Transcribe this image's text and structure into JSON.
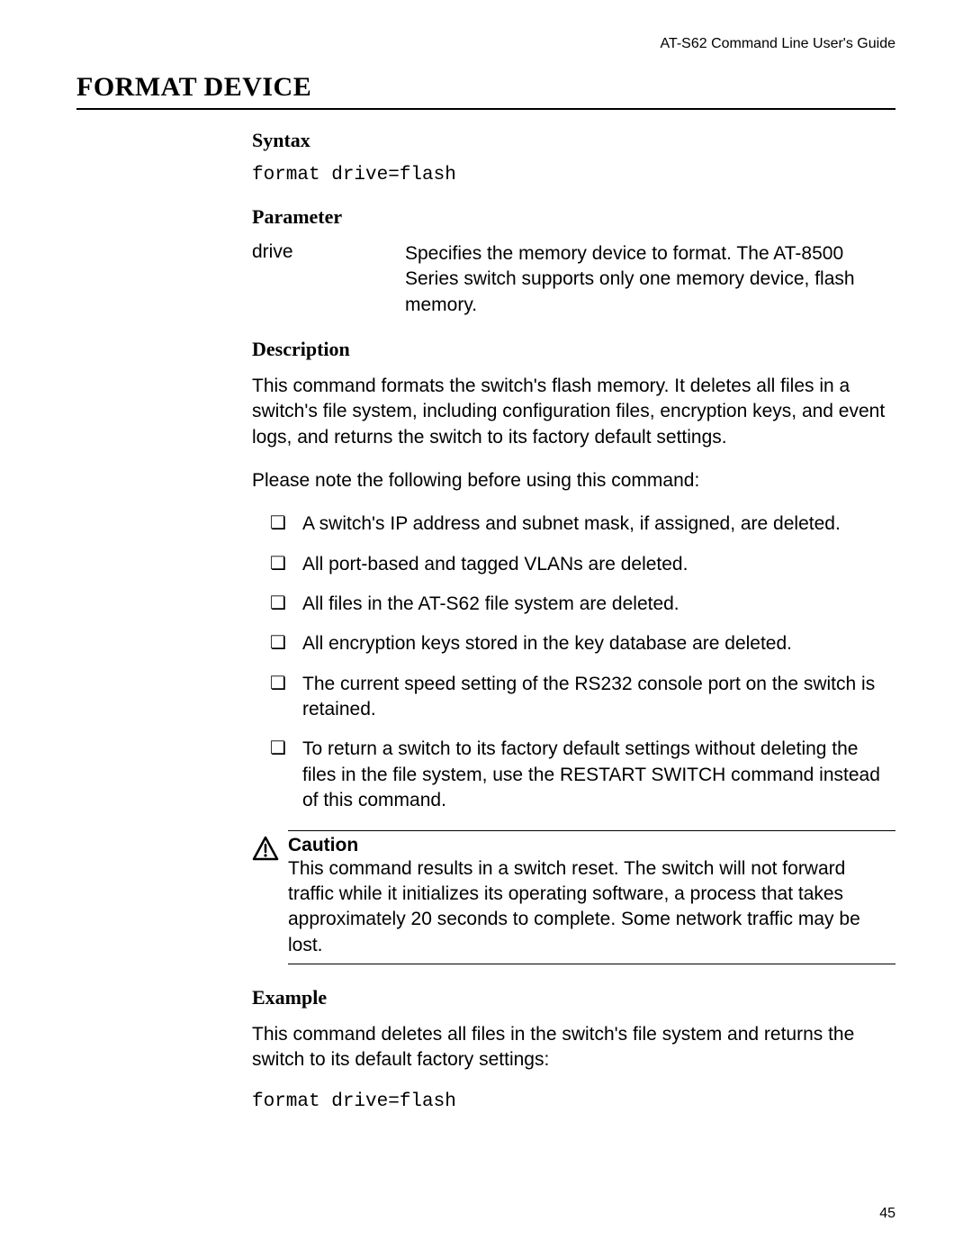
{
  "header": {
    "running": "AT-S62 Command Line User's Guide"
  },
  "title": "FORMAT DEVICE",
  "sections": {
    "syntax": {
      "heading": "Syntax",
      "code": "format drive=flash"
    },
    "parameter": {
      "heading": "Parameter",
      "name": "drive",
      "desc": "Specifies the memory device to format. The AT-8500 Series switch supports only one memory device, flash memory."
    },
    "description": {
      "heading": "Description",
      "para1": "This command formats the switch's flash memory. It deletes all files in a switch's file system, including configuration files, encryption keys, and event logs, and returns the switch to its factory default settings.",
      "para2": "Please note the following before using this command:",
      "bullets": [
        "A switch's IP address and subnet mask, if assigned, are deleted.",
        "All port-based and tagged VLANs are deleted.",
        "All files in the AT-S62 file system are deleted.",
        "All encryption keys stored in the key database are deleted.",
        "The current speed setting of the RS232 console port on the switch is retained.",
        "To return a switch to its factory default settings without deleting the files in the file system, use the RESTART SWITCH command instead of this command."
      ],
      "caution": {
        "title": "Caution",
        "text": "This command results in a switch reset. The switch will not forward traffic while it initializes its operating software, a process that takes approximately 20 seconds to complete. Some network traffic may be lost."
      }
    },
    "example": {
      "heading": "Example",
      "para": "This command deletes all files in the switch's file system and returns the switch to its default factory settings:",
      "code": "format drive=flash"
    }
  },
  "page_number": "45"
}
